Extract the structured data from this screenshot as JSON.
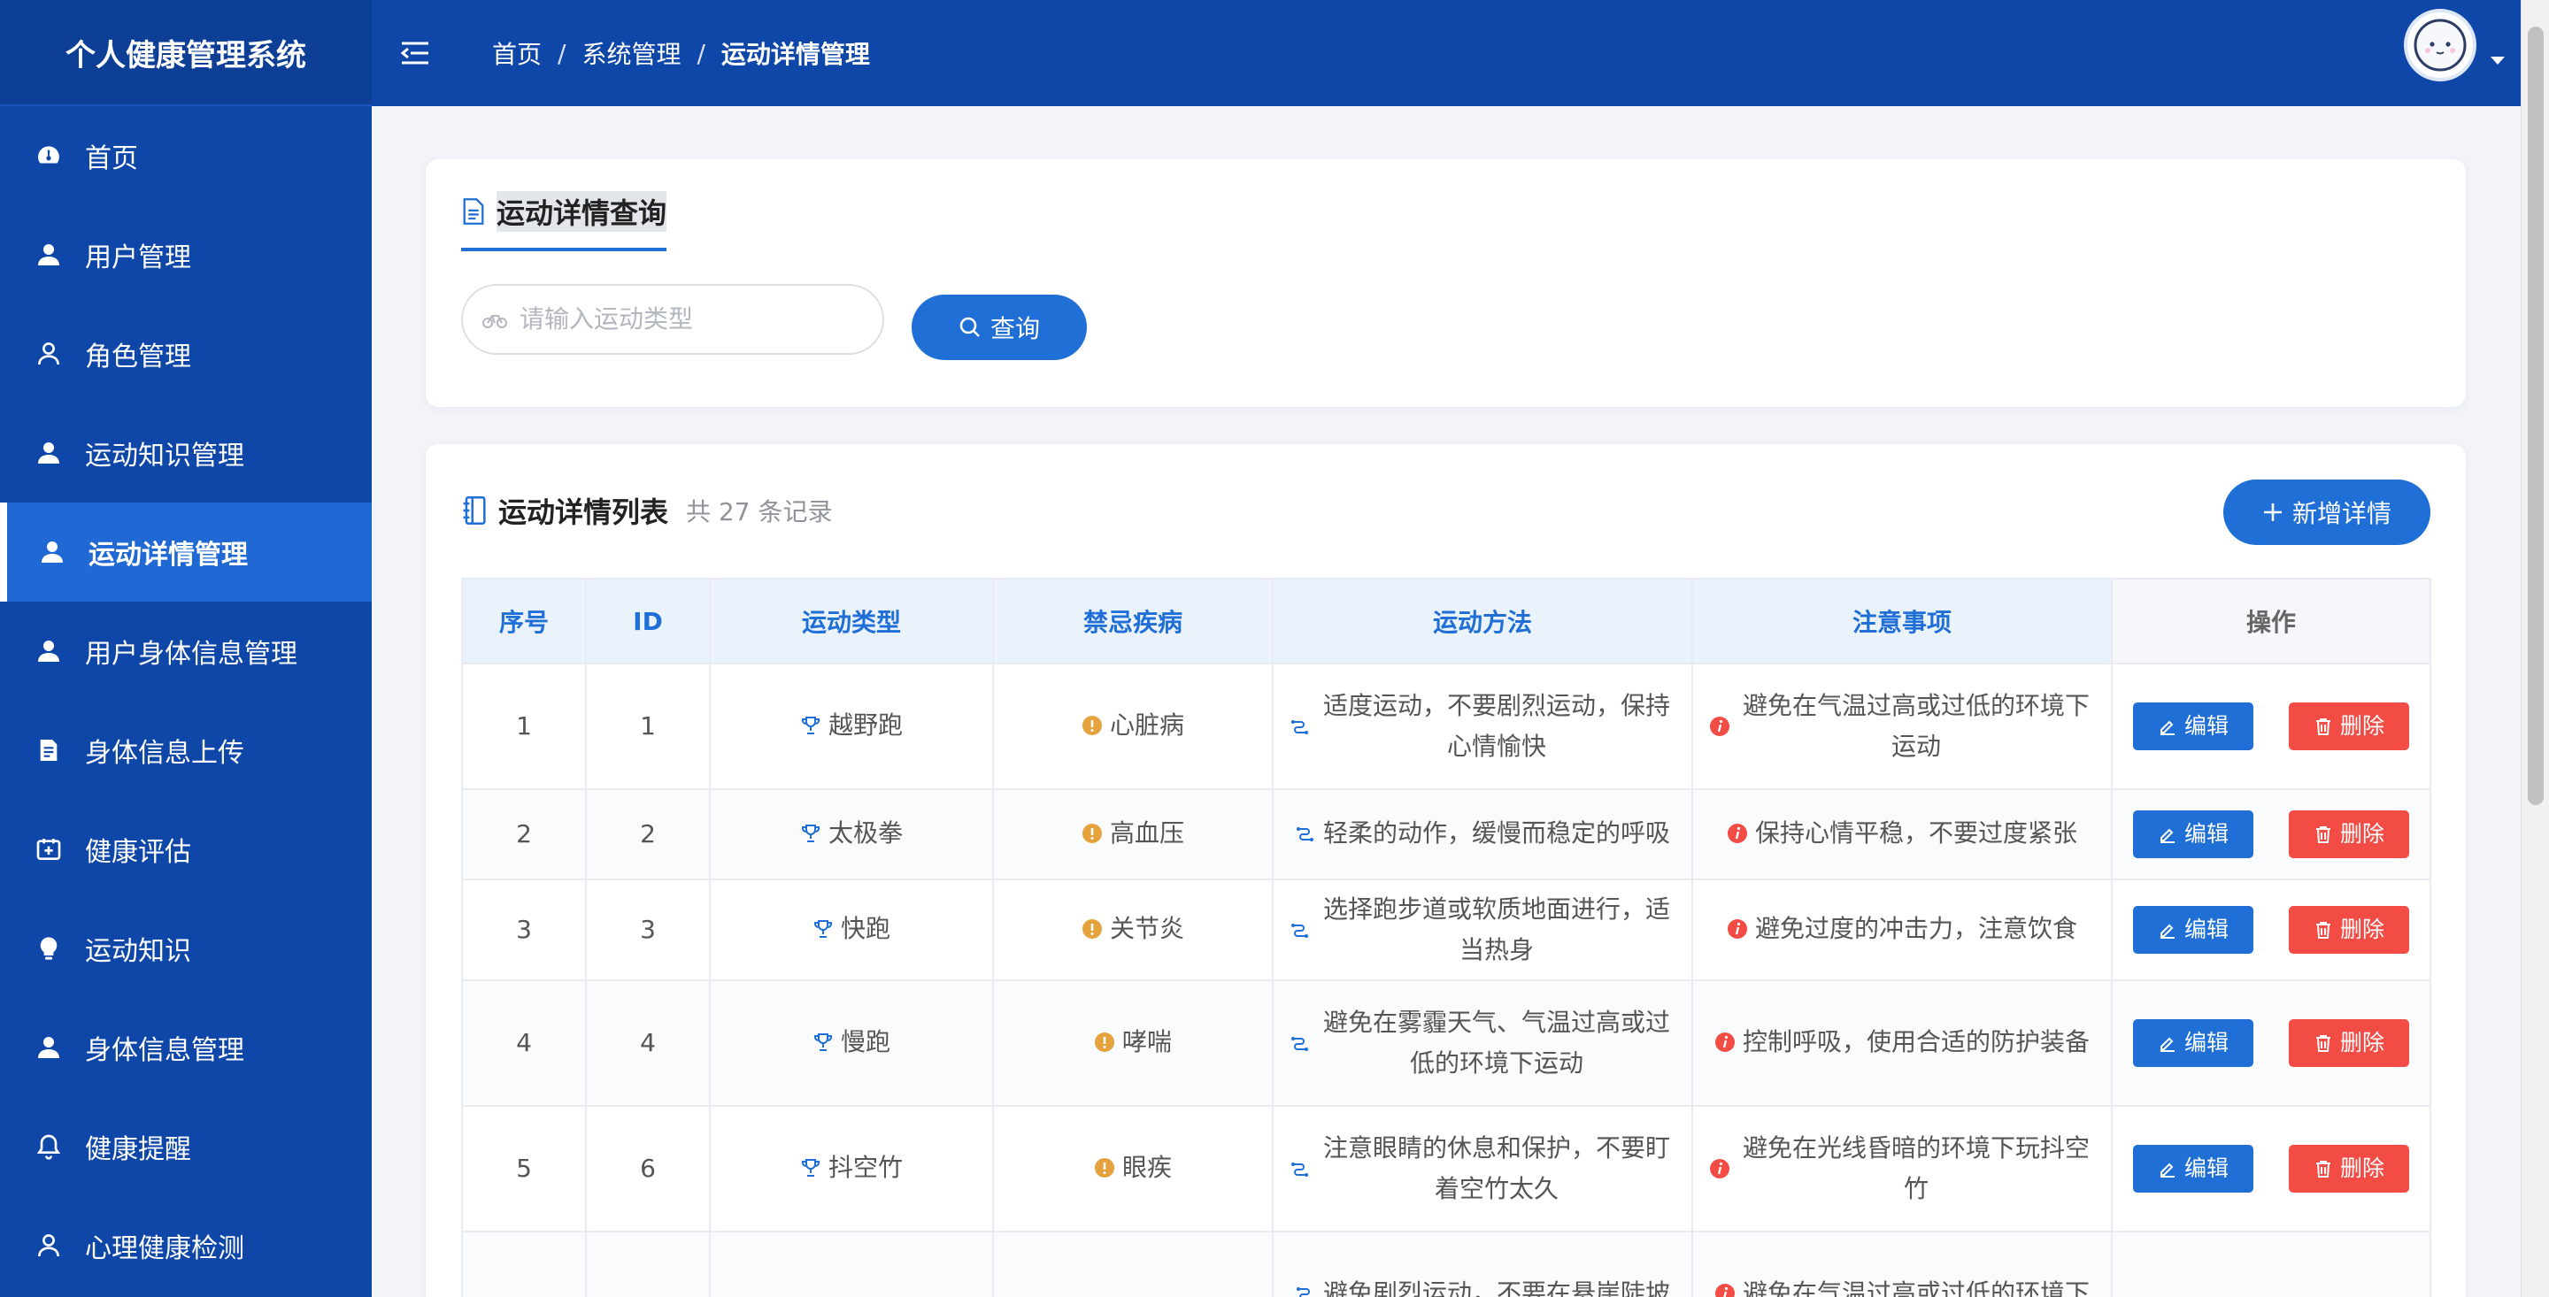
{
  "app": {
    "title": "个人健康管理系统"
  },
  "sidebar": {
    "items": [
      {
        "label": "首页",
        "icon": "dashboard-icon"
      },
      {
        "label": "用户管理",
        "icon": "user-icon"
      },
      {
        "label": "角色管理",
        "icon": "user-outline-icon"
      },
      {
        "label": "运动知识管理",
        "icon": "user-icon"
      },
      {
        "label": "运动详情管理",
        "icon": "user-icon",
        "active": true
      },
      {
        "label": "用户身体信息管理",
        "icon": "user-icon"
      },
      {
        "label": "身体信息上传",
        "icon": "document-icon"
      },
      {
        "label": "健康评估",
        "icon": "plus-box-icon"
      },
      {
        "label": "运动知识",
        "icon": "lightbulb-icon"
      },
      {
        "label": "身体信息管理",
        "icon": "user-icon"
      },
      {
        "label": "健康提醒",
        "icon": "bell-icon"
      },
      {
        "label": "心理健康检测",
        "icon": "user-outline-icon"
      }
    ]
  },
  "header": {
    "breadcrumb": [
      "首页",
      "系统管理",
      "运动详情管理"
    ],
    "separator": "/"
  },
  "query": {
    "title": "运动详情查询",
    "placeholder": "请输入运动类型",
    "button": "查询"
  },
  "list": {
    "title": "运动详情列表",
    "count_text": "共 27 条记录",
    "add_button": "新增详情"
  },
  "table": {
    "headers": [
      "序号",
      "ID",
      "运动类型",
      "禁忌疾病",
      "运动方法",
      "注意事项",
      "操作"
    ],
    "edit_label": "编辑",
    "delete_label": "删除",
    "rows": [
      {
        "no": "1",
        "id": "1",
        "type": "越野跑",
        "disease": "心脏病",
        "method": "适度运动，不要剧烈运动，保持心情愉快",
        "note": "避免在气温过高或过低的环境下运动"
      },
      {
        "no": "2",
        "id": "2",
        "type": "太极拳",
        "disease": "高血压",
        "method": "轻柔的动作，缓慢而稳定的呼吸",
        "note": "保持心情平稳，不要过度紧张"
      },
      {
        "no": "3",
        "id": "3",
        "type": "快跑",
        "disease": "关节炎",
        "method": "选择跑步道或软质地面进行，适当热身",
        "note": "避免过度的冲击力，注意饮食"
      },
      {
        "no": "4",
        "id": "4",
        "type": "慢跑",
        "disease": "哮喘",
        "method": "避免在雾霾天气、气温过高或过低的环境下运动",
        "note": "控制呼吸，使用合适的防护装备"
      },
      {
        "no": "5",
        "id": "6",
        "type": "抖空竹",
        "disease": "眼疾",
        "method": "注意眼睛的休息和保护，不要盯着空竹太久",
        "note": "避免在光线昏暗的环境下玩抖空竹"
      },
      {
        "no": "",
        "id": "",
        "type": "",
        "disease": "",
        "method": "避免剧烈运动，不要在悬崖陡坡",
        "note": "避免在气温过高或过低的环境下"
      }
    ]
  },
  "colors": {
    "primary": "#1f6fd6",
    "sidebar": "#0f47a8",
    "danger": "#f24c45",
    "warning": "#e6a23c"
  }
}
